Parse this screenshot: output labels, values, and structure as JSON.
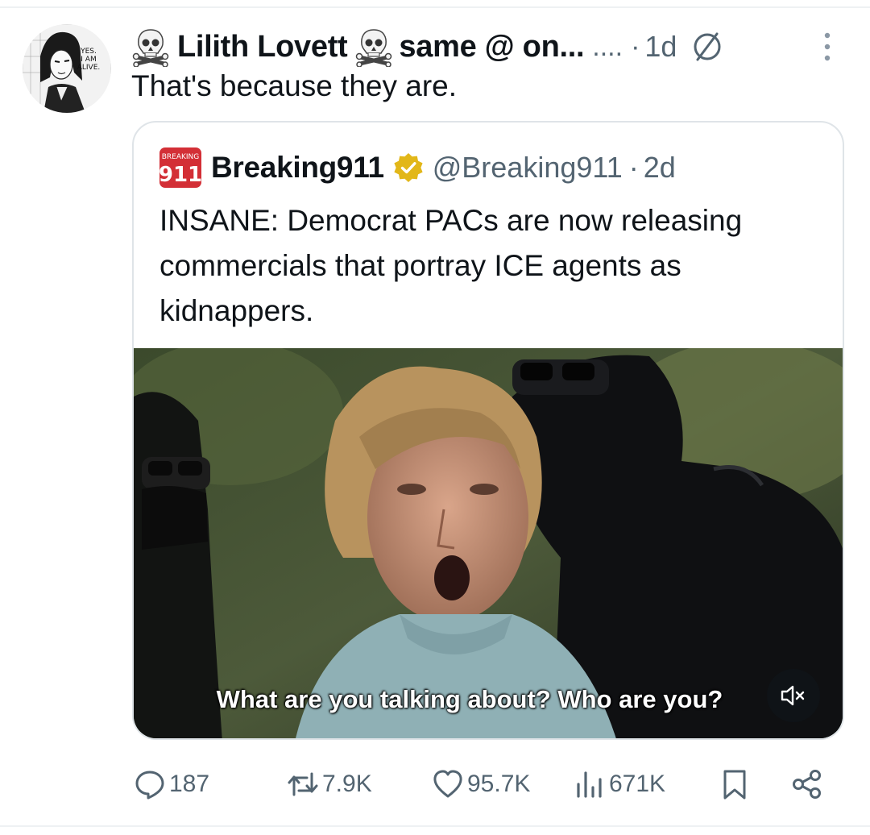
{
  "post": {
    "author": {
      "display_name": "Lilith Lovett",
      "name_suffix": "same @ on...",
      "truncation": "....",
      "avatar_icon": "manga-avatar-icon",
      "avatar_text": [
        "YES.",
        "I AM",
        "ALIVE."
      ],
      "name_emoji": "skull-crossbones-icon"
    },
    "separator": "·",
    "time": "1d",
    "edited_icon": "edited-icon",
    "more_icon": "more-options-icon",
    "text": "That's because they are."
  },
  "quote": {
    "logo_text_top": "BREAKING",
    "logo_text_main": "911",
    "name": "Breaking911",
    "verified_color": "#e2b719",
    "handle": "@Breaking911",
    "separator": "·",
    "time": "2d",
    "text": "INSANE: Democrat PACs are now releasing commercials that portray ICE agents as kidnappers.",
    "media": {
      "type": "video",
      "caption": "What are you talking about? Who are you?",
      "mute_icon": "muted-speaker-icon"
    }
  },
  "actions": {
    "replies": "187",
    "reposts": "7.9K",
    "likes": "95.7K",
    "views": "671K",
    "bookmark_icon": "bookmark-icon",
    "share_icon": "share-icon"
  },
  "colors": {
    "text_primary": "#0f1419",
    "text_secondary": "#536471",
    "border": "#dfe4e8",
    "logo_red": "#d32f36"
  }
}
